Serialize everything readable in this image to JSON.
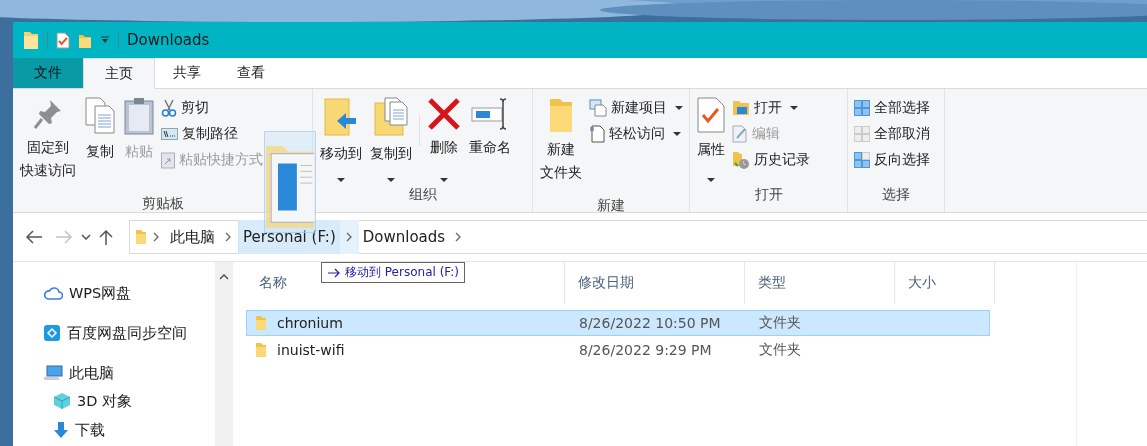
{
  "window": {
    "title": "Downloads"
  },
  "menu_tabs": [
    {
      "label": "文件",
      "kind": "file",
      "selected": false
    },
    {
      "label": "主页",
      "kind": "tab",
      "selected": true
    },
    {
      "label": "共享",
      "kind": "tab",
      "selected": false
    },
    {
      "label": "查看",
      "kind": "tab",
      "selected": false
    }
  ],
  "ribbon": {
    "groups": [
      {
        "label": "剪贴板",
        "items": [
          {
            "lines": [
              "固定到",
              "快速访问"
            ],
            "disabled": false
          },
          {
            "label": "复制",
            "disabled": false
          },
          {
            "label": "粘贴",
            "disabled": true
          },
          {
            "label": "剪切",
            "disabled": false
          },
          {
            "label": "复制路径",
            "disabled": false
          },
          {
            "label": "粘贴快捷方式",
            "disabled": true
          }
        ]
      },
      {
        "label": "组织",
        "items": [
          {
            "label": "移动到",
            "disabled": false
          },
          {
            "label": "复制到",
            "disabled": false
          },
          {
            "label": "删除",
            "disabled": false
          },
          {
            "label": "重命名",
            "disabled": false
          }
        ]
      },
      {
        "label": "新建",
        "items": [
          {
            "lines": [
              "新建",
              "文件夹"
            ],
            "disabled": false
          },
          {
            "label": "新建项目",
            "disabled": false
          },
          {
            "label": "轻松访问",
            "disabled": false
          }
        ]
      },
      {
        "label": "打开",
        "items": [
          {
            "label": "属性",
            "disabled": false
          },
          {
            "label": "打开",
            "disabled": false
          },
          {
            "label": "编辑",
            "disabled": true
          },
          {
            "label": "历史记录",
            "disabled": false
          }
        ]
      },
      {
        "label": "选择",
        "items": [
          {
            "label": "全部选择",
            "disabled": false
          },
          {
            "label": "全部取消",
            "disabled": false
          },
          {
            "label": "反向选择",
            "disabled": false
          }
        ]
      }
    ]
  },
  "address_bar": {
    "breadcrumbs": [
      {
        "label": "此电脑",
        "highlighted": false
      },
      {
        "label": "Personal (F:)",
        "highlighted": true
      },
      {
        "label": "Downloads",
        "highlighted": false
      }
    ]
  },
  "drag_tooltip": "移动到 Personal (F:)",
  "sidebar": {
    "items": [
      {
        "label": "WPS网盘"
      },
      {
        "label": "百度网盘同步空间"
      },
      {
        "label": "此电脑",
        "children": [
          {
            "label": "3D 对象"
          },
          {
            "label": "下载"
          }
        ]
      }
    ]
  },
  "table": {
    "columns": [
      "名称",
      "修改日期",
      "类型",
      "大小"
    ],
    "rows": [
      {
        "name": "chronium",
        "modified": "8/26/2022 10:50 PM",
        "type": "文件夹",
        "selected": true
      },
      {
        "name": "inuist-wifi",
        "modified": "8/26/2022 9:29 PM",
        "type": "文件夹",
        "selected": false
      }
    ]
  }
}
